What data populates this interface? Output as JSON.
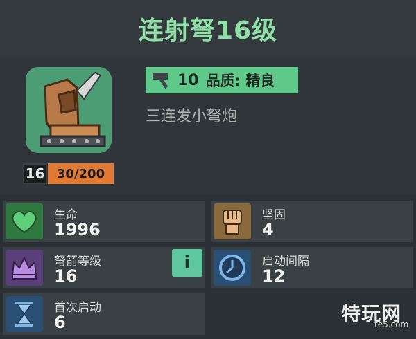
{
  "header": {
    "title": "连射弩16级"
  },
  "item": {
    "icon": "crossbow-turret-icon",
    "level": "16",
    "exp": "30/200",
    "quality_number": "10",
    "quality_text": "品质: 精良",
    "description": "三连发小弩炮"
  },
  "stats": [
    {
      "label": "生命",
      "value": "1996",
      "icon": "heart-icon",
      "color": "#2e7a3e"
    },
    {
      "label": "坚固",
      "value": "4",
      "icon": "fist-icon",
      "color": "#8a6a3c"
    },
    {
      "label": "弩箭等级",
      "value": "16",
      "icon": "crown-icon",
      "color": "#5a3f7a"
    },
    {
      "label": "启动间隔",
      "value": "12",
      "icon": "clock-icon",
      "color": "#2a4f74"
    },
    {
      "label": "首次启动",
      "value": "6",
      "icon": "hourglass-icon",
      "color": "#2a4f74"
    }
  ],
  "info_button": {
    "label": "i"
  },
  "watermark": {
    "name": "特玩网",
    "site": "te5.com"
  },
  "colors": {
    "accent_green": "#8fe0a6",
    "badge_green": "#5fc98a",
    "exp_orange": "#e07a34"
  }
}
